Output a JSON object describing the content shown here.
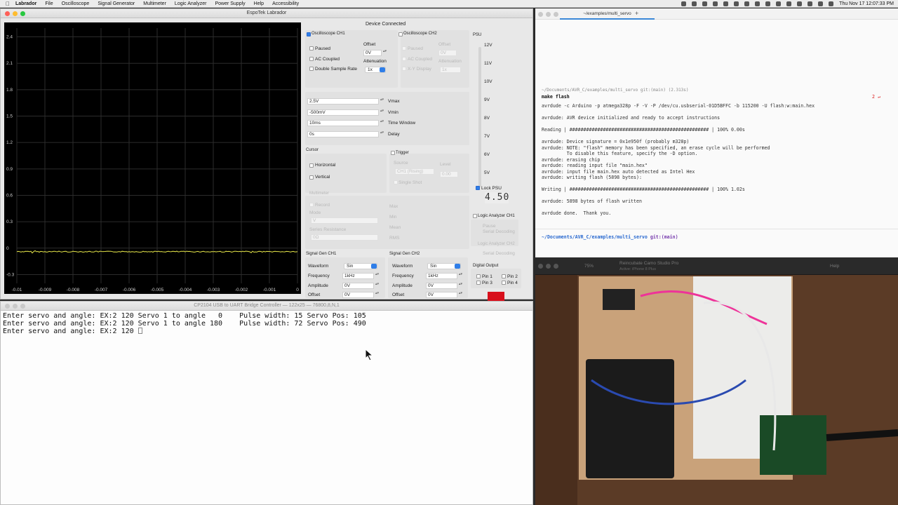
{
  "menubar": {
    "app": "Labrador",
    "items": [
      "File",
      "Oscilloscope",
      "Signal Generator",
      "Multimeter",
      "Logic Analyzer",
      "Power Supply",
      "Help",
      "Accessibility"
    ],
    "clock": "Thu Nov 17  12:07:33 PM"
  },
  "labrador": {
    "title": "EspoTek Labrador",
    "scope": {
      "y_ticks": [
        "2.4",
        "2.1",
        "1.8",
        "1.5",
        "1.2",
        "0.9",
        "0.6",
        "0.3",
        "0",
        "-0.3"
      ],
      "x_ticks": [
        "-0.01",
        "-0.009",
        "-0.008",
        "-0.007",
        "-0.006",
        "-0.005",
        "-0.004",
        "-0.003",
        "-0.002",
        "-0.001",
        "0"
      ],
      "trace_color": "#e8e84a"
    },
    "status": "Device Connected",
    "ch1": {
      "label": "Oscilloscope CH1",
      "paused": "Paused",
      "ac": "AC Coupled",
      "dsr": "Double Sample Rate",
      "offset_label": "Offset",
      "offset": "0V",
      "atten_label": "Attenuation",
      "atten": "1x"
    },
    "ch2": {
      "label": "Oscilloscope CH2",
      "paused": "Paused",
      "ac": "AC Coupled",
      "xy": "X-Y Display",
      "offset_label": "Offset",
      "offset": "0V",
      "atten_label": "Attenuation",
      "atten": "1x"
    },
    "display": {
      "vmax": "2.5V",
      "vmax_label": "Vmax",
      "vmin": "-500mV",
      "vmin_label": "Vmin",
      "window": "10ms",
      "window_label": "Time Window",
      "delay": "0s",
      "delay_label": "Delay"
    },
    "cursor": {
      "label": "Cursor",
      "horizontal": "Horizontal",
      "vertical": "Vertical"
    },
    "trigger": {
      "label": "Trigger",
      "source_label": "Source",
      "source": "CH1 (Rising)",
      "level_label": "Level",
      "level": "0.00",
      "single": "Single Shot"
    },
    "multimeter": {
      "label": "Multimeter",
      "record": "Record",
      "mode_label": "Mode",
      "mode": "V",
      "series_label": "Series Resistance",
      "series": "0Ω",
      "max": "Max",
      "min": "Min",
      "mean": "Mean",
      "rms": "RMS"
    },
    "psu": {
      "label": "PSU",
      "ticks": [
        "12V",
        "11V",
        "10V",
        "9V",
        "8V",
        "7V",
        "6V",
        "5V"
      ],
      "lock": "Lock PSU",
      "readout": "4.50"
    },
    "logic": {
      "ch1": "Logic Analyzer CH1",
      "ch2": "Logic Analyzer CH2",
      "pause": "Pause",
      "serial": "Serial Decoding"
    },
    "gen1": {
      "label": "Signal Gen CH1",
      "waveform_label": "Waveform",
      "waveform": "Sin",
      "freq_label": "Frequency",
      "freq": "1kHz",
      "amp_label": "Amplitude",
      "amp": "0V",
      "offset_label": "Offset",
      "offset": "0V"
    },
    "gen2": {
      "label": "Signal Gen CH2",
      "waveform_label": "Waveform",
      "waveform": "Sin",
      "freq_label": "Frequency",
      "freq": "1kHz",
      "amp_label": "Amplitude",
      "amp": "0V",
      "offset_label": "Offset",
      "offset": "0V"
    },
    "digital": {
      "label": "Digital Output",
      "pin1": "Pin 1",
      "pin2": "Pin 2",
      "pin3": "Pin 3",
      "pin4": "Pin 4"
    }
  },
  "editor": {
    "tab": "~/examples/multi_servo",
    "prompt": "~/Documents/AVR_C/examples/multi_servo git:(main) (2.313s)",
    "command": "make flash",
    "badge": "2 ↵",
    "lines": [
      "avrdude -c Arduino -p atmega328p -F -V -P /dev/cu.usbserial-01D5BFFC -b 115200 -U flash:w:main.hex",
      "",
      "avrdude: AVR device initialized and ready to accept instructions",
      "",
      "Reading | ################################################## | 100% 0.00s",
      "",
      "avrdude: Device signature = 0x1e950f (probably m328p)",
      "avrdude: NOTE: \"flash\" memory has been specified, an erase cycle will be performed",
      "         To disable this feature, specify the -D option.",
      "avrdude: erasing chip",
      "avrdude: reading input file \"main.hex\"",
      "avrdude: input file main.hex auto detected as Intel Hex",
      "avrdude: writing flash (5898 bytes):",
      "",
      "Writing | ################################################## | 100% 1.02s",
      "",
      "avrdude: 5898 bytes of flash written",
      "",
      "avrdude done.  Thank you."
    ],
    "prompt2_path": "~/Documents/AVR_C/examples/multi_servo",
    "prompt2_git": "git:(main)"
  },
  "camo": {
    "title": "Reincubate Camo Studio Pro",
    "subtitle": "Active: iPhone 8 Plus",
    "zoom": "75%",
    "help": "Help"
  },
  "serial": {
    "title": "CP2104 USB to UART Bridge Controller — 122x25 — 76800,8,N,1",
    "lines": [
      "Enter servo and angle: EX:2 120 Servo 1 to angle   0    Pulse width: 15 Servo Pos: 105",
      "Enter servo and angle: EX:2 120 Servo 1 to angle 180    Pulse width: 72 Servo Pos: 490",
      "Enter servo and angle: EX:2 120 "
    ]
  }
}
